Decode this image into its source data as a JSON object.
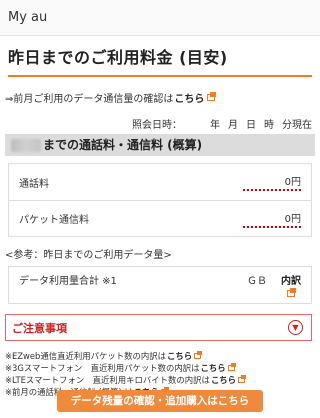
{
  "header": {
    "brand": "My au"
  },
  "page": {
    "title": "昨日までのご利用料金 (目安)"
  },
  "prev_month": {
    "text": "⇒前月ご利用のデータ通信量の確認は",
    "link": "こちら"
  },
  "reference": {
    "label": "照会日時：",
    "year": "年",
    "month": "月",
    "day": "日",
    "hour": "時",
    "minute": "分現在"
  },
  "section": {
    "title": "までの通話料・通信料 (概算)"
  },
  "fees": [
    {
      "label": "通話料",
      "value": "0円"
    },
    {
      "label": "パケット通信料",
      "value": "0円"
    }
  ],
  "usage": {
    "heading": "<参考：昨日までのご利用データ量>",
    "label": "データ利用量合計 ※1",
    "unit": "ＧＢ",
    "detail": "内訳"
  },
  "notice": {
    "title": "ご注意事項"
  },
  "notes": [
    {
      "text": "※EZweb通信直近利用パケット数の内訳は",
      "link": "こちら"
    },
    {
      "text": "※3Gスマートフォン　直近利用パケット数の内訳は",
      "link": "こちら"
    },
    {
      "text": "※LTEスマートフォン　直近利用キロバイト数の内訳は",
      "link": "こちら"
    },
    {
      "text": "※前月の通話料・通信料 (概算) は",
      "link": "こちら"
    }
  ],
  "cta": {
    "label": "データ残量の確認・追加購入はこちら"
  },
  "colors": {
    "accent": "#ef7c29",
    "alert": "#d21f1f",
    "section_bg": "#dcdcdc"
  },
  "icons": {
    "external": "external-link-icon",
    "chevron": "chevron-down-icon"
  }
}
